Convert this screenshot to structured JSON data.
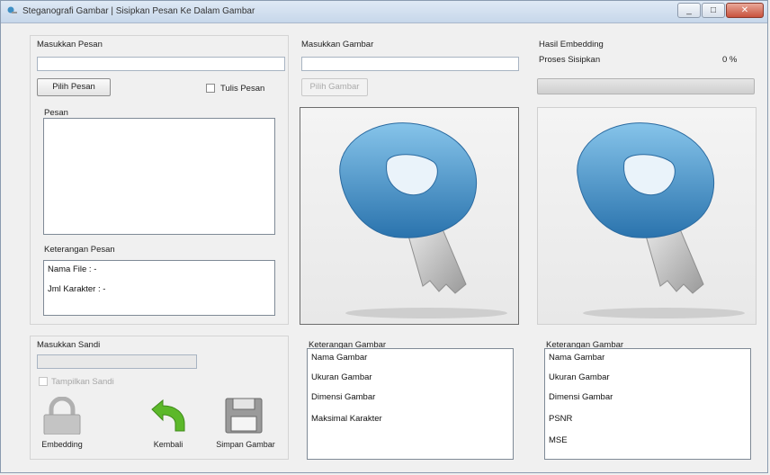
{
  "window": {
    "title": "Steganografi Gambar | Sisipkan Pesan Ke Dalam Gambar",
    "minimize_label": "_",
    "maximize_label": "□",
    "close_label": "✕"
  },
  "message_panel": {
    "heading": "Masukkan Pesan",
    "input_value": "",
    "choose_button": "Pilih Pesan",
    "type_checkbox_label": "Tulis Pesan",
    "message_label": "Pesan",
    "info_label": "Keterangan Pesan",
    "info_items": [
      "Nama File : -",
      "Jml Karakter : -"
    ]
  },
  "password_panel": {
    "heading": "Masukkan Sandi",
    "input_value": "",
    "checkbox_label": "Tampilkan Sandi",
    "embed_label": "Embedding",
    "back_label": "Kembali",
    "save_label": "Simpan Gambar"
  },
  "image_panel": {
    "heading": "Masukkan Gambar",
    "input_value": "",
    "choose_button": "Pilih Gambar",
    "info_label": "Keterangan Gambar",
    "info_items": [
      "Nama Gambar",
      "Ukuran Gambar",
      "Dimensi Gambar",
      "Maksimal Karakter"
    ]
  },
  "result_panel": {
    "heading": "Hasil Embedding",
    "progress_label": "Proses Sisipkan",
    "progress_value": "0 %",
    "progress_fraction": 0,
    "info_label": "Keterangan Gambar",
    "info_items": [
      "Nama Gambar",
      "Ukuran Gambar",
      "Dimensi Gambar",
      "PSNR",
      "MSE"
    ]
  },
  "icons": {
    "app": "lock-key-icon",
    "key": "key-icon",
    "embed": "padlock-icon",
    "back": "undo-arrow-icon",
    "save": "floppy-disk-icon"
  },
  "colors": {
    "key_blue": "#3f8fc4",
    "key_silver": "#c8c8c8",
    "back_green": "#5cb82a"
  }
}
